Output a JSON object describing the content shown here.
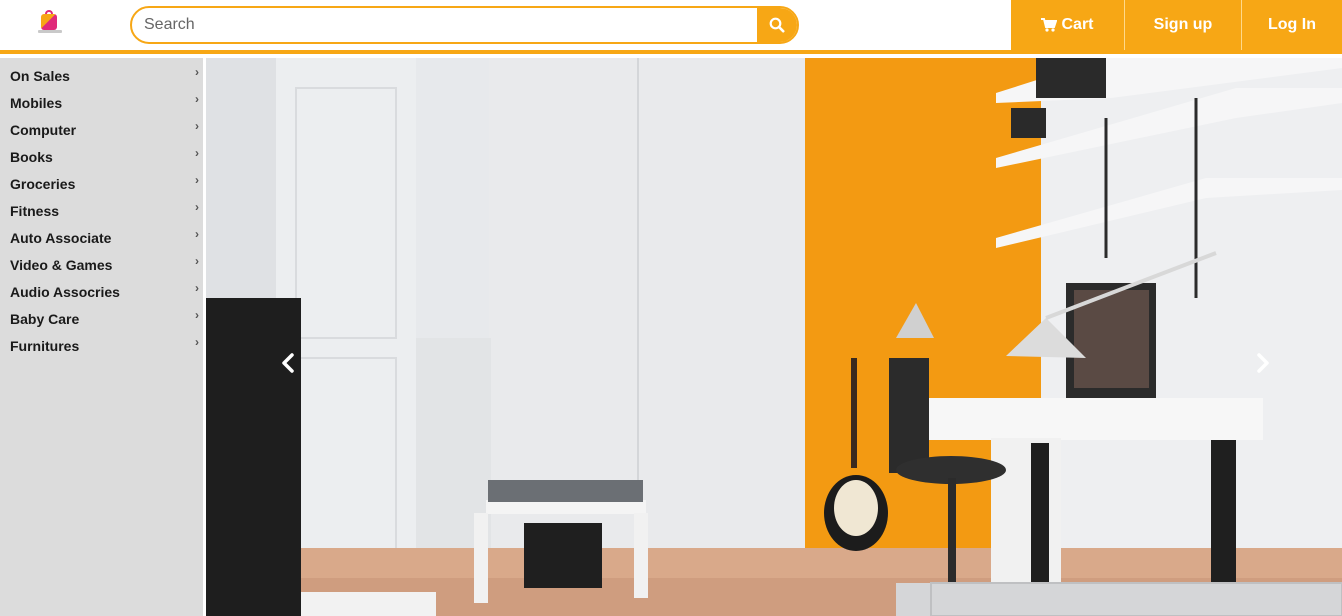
{
  "header": {
    "logo_icon": "shopping-bag-logo",
    "search": {
      "placeholder": "Search",
      "value": "",
      "button_icon": "search-icon"
    },
    "nav": {
      "cart_label": "Cart",
      "cart_icon": "cart-icon",
      "signup_label": "Sign up",
      "login_label": "Log In"
    }
  },
  "sidebar": {
    "items": [
      {
        "label": "On Sales"
      },
      {
        "label": "Mobiles"
      },
      {
        "label": "Computer"
      },
      {
        "label": "Books"
      },
      {
        "label": "Groceries"
      },
      {
        "label": "Fitness"
      },
      {
        "label": "Auto Associate"
      },
      {
        "label": "Video & Games"
      },
      {
        "label": "Audio Assocries"
      },
      {
        "label": "Baby Care"
      },
      {
        "label": "Furnitures"
      }
    ],
    "chevron_icon": "chevron-right-icon"
  },
  "carousel": {
    "image": "room-with-orange-wall-desk-and-guitar",
    "prev_icon": "chevron-left-icon",
    "next_icon": "chevron-right-icon"
  },
  "colors": {
    "accent": "#f7a715",
    "sidebar_bg": "#dcdcdc",
    "white": "#ffffff"
  }
}
